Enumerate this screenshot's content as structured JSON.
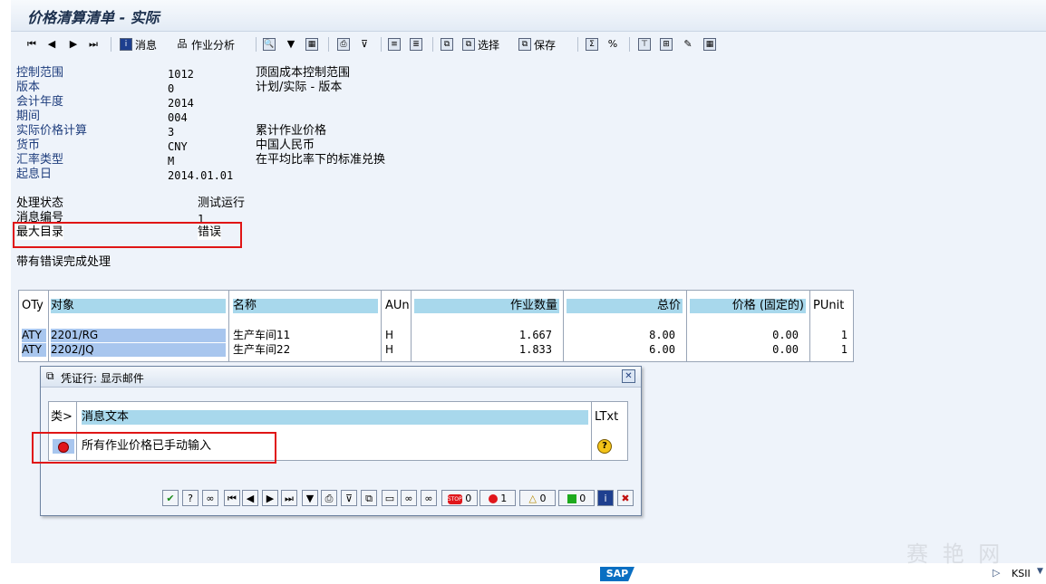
{
  "window": {
    "title": "价格清算清单 - 实际"
  },
  "toolbar": {
    "message": "消息",
    "activity_analysis": "作业分析",
    "select": "选择",
    "save": "保存"
  },
  "header_fields": [
    {
      "label": "控制范围",
      "value": "1012",
      "text": "顶固成本控制范围"
    },
    {
      "label": "版本",
      "value": "0",
      "text": "计划/实际 - 版本"
    },
    {
      "label": "会计年度",
      "value": "2014",
      "text": ""
    },
    {
      "label": "期间",
      "value": "004",
      "text": ""
    },
    {
      "label": "实际价格计算",
      "value": "3",
      "text": "累计作业价格"
    },
    {
      "label": "货币",
      "value": "CNY",
      "text": "中国人民币"
    },
    {
      "label": "汇率类型",
      "value": "M",
      "text": "在平均比率下的标准兑换"
    },
    {
      "label": "起息日",
      "value": "2014.01.01",
      "text": ""
    }
  ],
  "processing": [
    {
      "label": "处理状态",
      "value": "测试运行"
    },
    {
      "label": "消息编号",
      "value": "1"
    },
    {
      "label": "最大目录",
      "value": "错误"
    }
  ],
  "completion_text": "带有错误完成处理",
  "grid": {
    "columns": [
      "OTy",
      "对象",
      "名称",
      "AUn",
      "作业数量",
      "总价",
      "价格 (固定的)",
      "PUnit"
    ],
    "rows": [
      [
        "ATY",
        "2201/RG",
        "生产车间11",
        "H",
        "1.667",
        "8.00",
        "0.00",
        "1"
      ],
      [
        "ATY",
        "2202/JQ",
        "生产车间22",
        "H",
        "1.833",
        "6.00",
        "0.00",
        "1"
      ]
    ]
  },
  "dialog": {
    "title": "凭证行: 显示邮件",
    "columns": [
      "类>",
      "消息文本",
      "LTxt"
    ],
    "rows": [
      {
        "text": "所有作业价格已手动输入"
      }
    ],
    "counts": {
      "stop": "0",
      "error": "1",
      "warning": "0",
      "success": "0"
    }
  },
  "statusbar": {
    "logo": "SAP",
    "system": "KSII"
  },
  "watermark": "赛 艳 网",
  "colors": {
    "accent_red": "#e01515",
    "header_blue": "#a8d8ec",
    "selection": "#a8c6ee"
  }
}
